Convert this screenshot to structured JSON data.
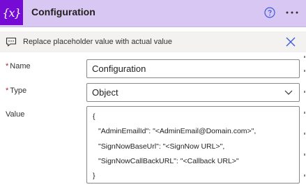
{
  "header": {
    "icon_text": "{x}",
    "title": "Configuration",
    "help_icon": "help-circle-icon",
    "more_icon": "ellipsis-icon",
    "color": "#d9c7f3",
    "icon_color": "#770bd6"
  },
  "info_bar": {
    "icon": "comment-icon",
    "text": "Replace placeholder value with actual value",
    "close_icon": "close-icon"
  },
  "form": {
    "name": {
      "required_mark": "*",
      "label": "Name",
      "value": "Configuration"
    },
    "type": {
      "required_mark": "*",
      "label": "Type",
      "value": "Object"
    },
    "value": {
      "label": "Value",
      "lines": [
        "{",
        "\"AdminEmailId\": \"<AdminEmail@Domain.com>\",",
        "\"SignNowBaseUrl\": \"<SignNow URL>\",",
        "\"SignNowCallBackURL\": \"<Callback URL>\"",
        "}"
      ]
    }
  }
}
